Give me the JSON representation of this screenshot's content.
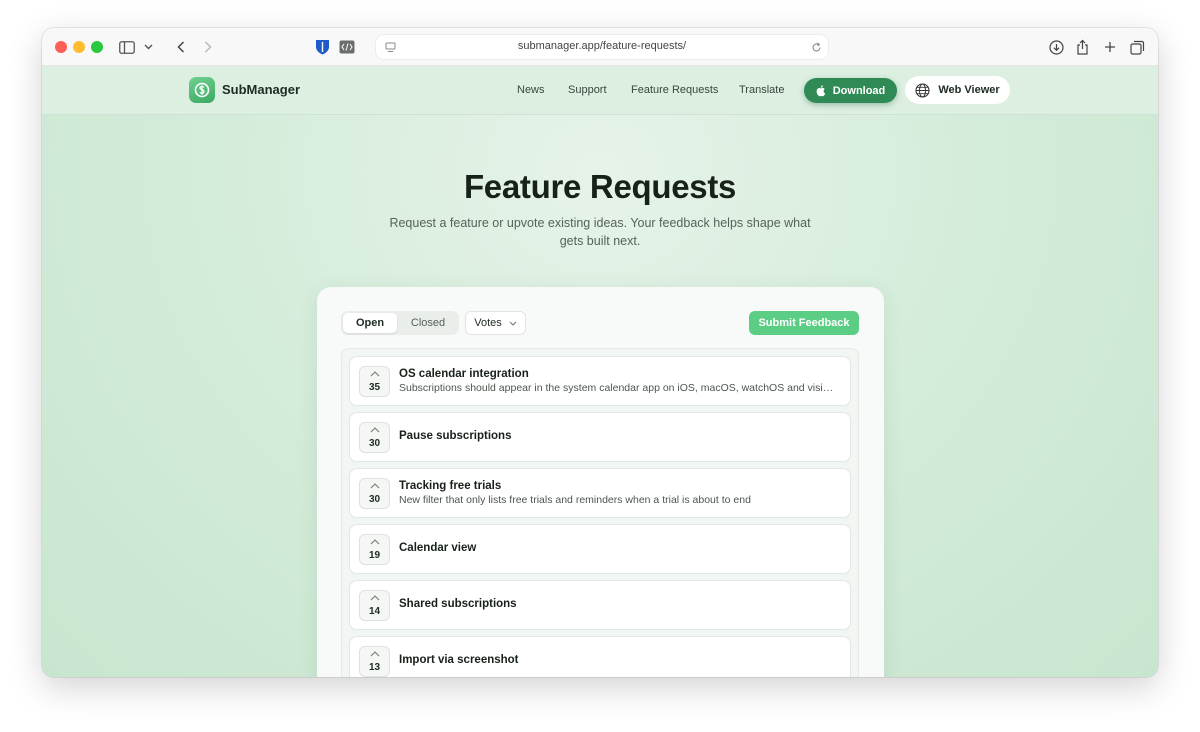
{
  "browser": {
    "url": "submanager.app/feature-requests/"
  },
  "site": {
    "brand": "SubManager",
    "nav": [
      "News",
      "Support",
      "Feature Requests",
      "Translate"
    ],
    "download_label": "Download",
    "web_viewer_label": "Web Viewer"
  },
  "page": {
    "title": "Feature Requests",
    "subtitle": "Request a feature or upvote existing ideas. Your feedback helps shape what gets built next."
  },
  "board": {
    "tabs": [
      "Open",
      "Closed"
    ],
    "active_tab": "Open",
    "sort_label": "Votes",
    "submit_label": "Submit Feedback",
    "requests": [
      {
        "votes": "35",
        "title": "OS calendar integration",
        "description": "Subscriptions should appear in the system calendar app on iOS, macOS, watchOS and visionOS"
      },
      {
        "votes": "30",
        "title": "Pause subscriptions",
        "description": ""
      },
      {
        "votes": "30",
        "title": "Tracking free trials",
        "description": "New filter that only lists free trials and reminders when a trial is about to end"
      },
      {
        "votes": "19",
        "title": "Calendar view",
        "description": ""
      },
      {
        "votes": "14",
        "title": "Shared subscriptions",
        "description": ""
      },
      {
        "votes": "13",
        "title": "Import via screenshot",
        "description": ""
      }
    ]
  },
  "colors": {
    "accent": "#2f8a55",
    "submit": "#5ccd85",
    "page_bg": "#cfe9d6"
  }
}
